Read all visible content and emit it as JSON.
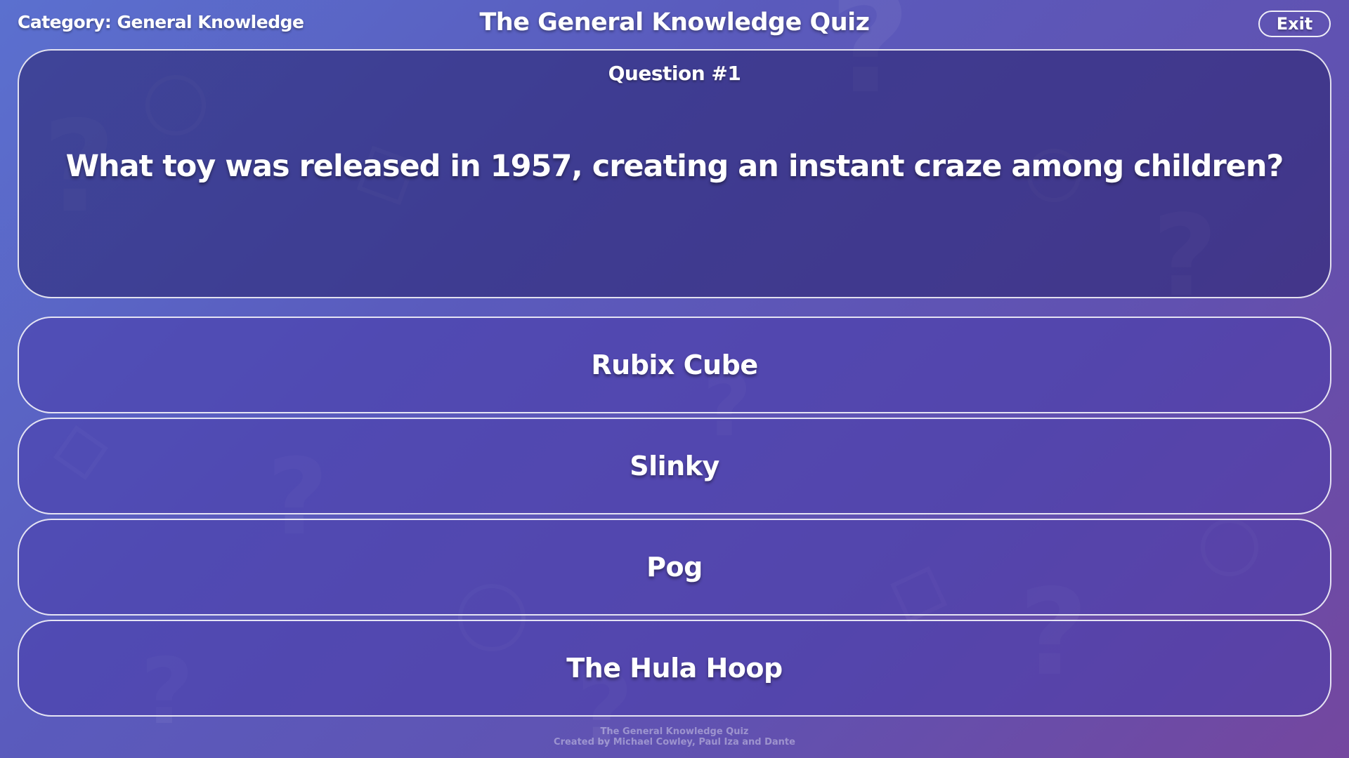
{
  "header": {
    "category": "Category: General Knowledge",
    "title": "The General Knowledge Quiz",
    "exit_label": "Exit"
  },
  "question": {
    "number_label": "Question #1",
    "text": "What toy was released in 1957, creating an instant craze among children?"
  },
  "answers": [
    {
      "label": "Rubix Cube"
    },
    {
      "label": "Slinky"
    },
    {
      "label": "Pog"
    },
    {
      "label": "The Hula Hoop"
    }
  ],
  "footer": {
    "line1": "The General Knowledge Quiz",
    "line2": "Created by Michael Cowley, Paul Iza and Dante"
  },
  "colors": {
    "background_start": "#5b70cf",
    "background_end": "#74479f",
    "text": "#ffffff"
  },
  "icons": {
    "background_pattern": "question-mark-pattern"
  }
}
